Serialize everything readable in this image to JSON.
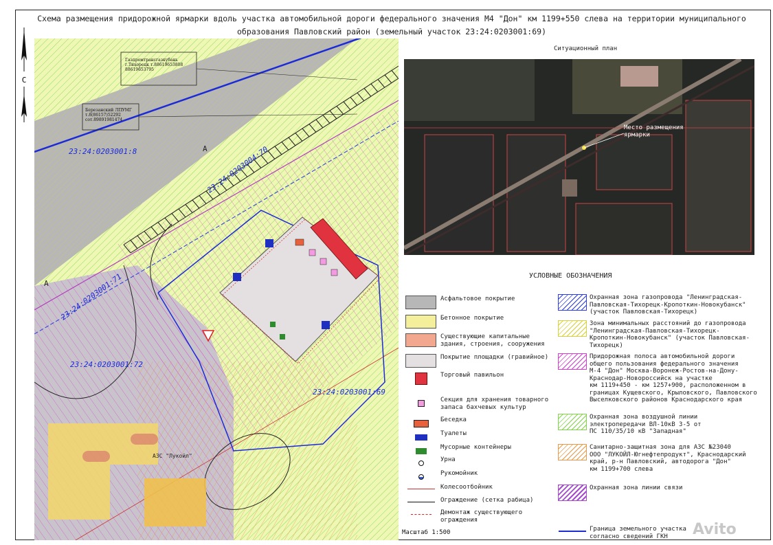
{
  "title": {
    "line1": "Схема размещения придорожной ярмарки вдоль участка автомобильной дороги федерального значения М4 \"Дон\" км 1199+550 слева на территории муниципального",
    "line2": "образования Павловский район (земельный участок 23:24:0203001:69)"
  },
  "north_letter": "С",
  "map": {
    "parcels": [
      "23:24:0203001:8",
      "23:24:0203004:70",
      "23:24:0203001:71",
      "23:24:0203001:72",
      "23:24:0203001:69"
    ],
    "callouts": [
      "Газпромтрансгазкубань\nг.Тихорецк т.88619653808\n88619653795",
      "Березанский ЛПУМГ\nт.8(86157)52292\nсот.89891981474"
    ],
    "station_label": "АЗС \"Лукойл\"",
    "zone_letter": "А",
    "colors": {
      "concrete": "#f3ef9a",
      "asphalt": "#b7b7b7",
      "gravel": "#e4dfe0",
      "buildings": "#f2a88e",
      "pavilion": "#e0323f",
      "toilet": "#1f2fbf",
      "container": "#2e8b2e",
      "boundary": "#1c2bd6",
      "hatch_green": "#7fd64a",
      "hatch_magenta": "#d23fd0",
      "hatch_orange": "#e89a4a",
      "hatch_blue": "#2a3de0",
      "gas_yellow": "#e8e24a"
    }
  },
  "situation": {
    "title": "Ситуационный план",
    "marker_label": "Место размещения\nярмарки"
  },
  "legend": {
    "title": "УСЛОВНЫЕ ОБОЗНАЧЕНИЯ",
    "left": [
      {
        "label": "Асфальтовое покрытие",
        "icon": "gray-fill"
      },
      {
        "label": "Бетонное покрытие",
        "icon": "yellow-fill"
      },
      {
        "label": "Существующие капитальные\nздания, строения, сооружения",
        "icon": "salmon-fill"
      },
      {
        "label": "Покрытие площадки (гравийное)",
        "icon": "light-gray-fill"
      },
      {
        "label": "Торговый павильон",
        "icon": "red-square"
      },
      {
        "label": "Секция для хранения товарного\nзапаса бахчевых культур",
        "icon": "pink-square"
      },
      {
        "label": "Беседка",
        "icon": "orange-rect"
      },
      {
        "label": "Туалеты",
        "icon": "blue-rect"
      },
      {
        "label": "Мусорные контейнеры",
        "icon": "green-rect"
      },
      {
        "label": "Урна",
        "icon": "circle"
      },
      {
        "label": "Рукомойник",
        "icon": "half-circle"
      },
      {
        "label": "Колесоотбойник",
        "icon": "red-line"
      },
      {
        "label": "Ограждение (сетка рабица)",
        "icon": "fence-line"
      },
      {
        "label": "Демонтаж существующего ограждения",
        "icon": "red-x-line"
      }
    ],
    "right": [
      {
        "label": "Охранная зона газопровода \"Ленинградская-\nПавловская-Тихорецк-Кропоткин-Новокубанск\"\n(участок Павловская-Тихорецк)",
        "icon": "blue-hatch"
      },
      {
        "label": "Зона минимальных расстояний до газопровода\n\"Ленинградская-Павловская-Тихорецк-\nКропоткин-Новокубанск\" (участок Павловская-\nТихорецк)",
        "icon": "yellow-hatch"
      },
      {
        "label": "Придорожная полоса автомобильной дороги\nобщего пользования федерального значения\nМ-4 \"Дон\" Москва-Воронеж-Ростов-на-Дону-\nКраснодар-Новороссийск на участке\nкм 1119+450 - км 1257+900, расположенном в\nграницах Кущевского, Крыловского, Павловского\nВыселковского районов Краснодарского края",
        "icon": "magenta-hatch"
      },
      {
        "label": "Охранная зона  воздушной линии\nэлектропередачи ВЛ-10кВ 3-5 от\nПС 110/35/10 кВ \"Западная\"",
        "icon": "green-hatch"
      },
      {
        "label": "Санитарно-защитная зона для АЗС №23040\nООО \"ЛУКОЙЛ-Югнефтепродукт\", Краснодарский\nкрай, р-н Павловский, автодорога \"Дон\"\nкм 1199+700 слева",
        "icon": "orange-hatch"
      },
      {
        "label": "Охранная зона линии связи",
        "icon": "purple-hatch"
      },
      {
        "label": "Граница земельного участка\nсогласно сведений ГКН",
        "icon": "blue-line"
      }
    ]
  },
  "scale": "Масштаб 1:500",
  "watermark": "Avito"
}
